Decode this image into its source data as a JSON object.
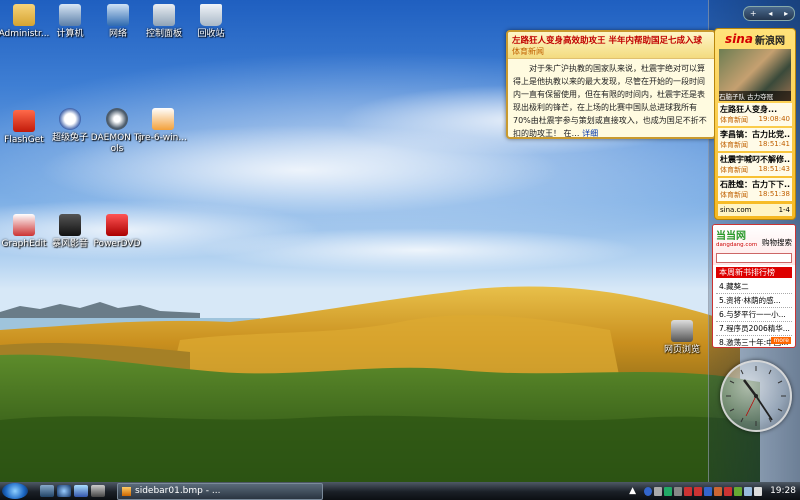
{
  "desktop": {
    "icons": [
      {
        "label": "Administr..."
      },
      {
        "label": "计算机"
      },
      {
        "label": "网络"
      },
      {
        "label": "控制面板"
      },
      {
        "label": "回收站"
      },
      {
        "label": "FlashGet"
      },
      {
        "label": "超级兔子"
      },
      {
        "label": "DAEMON Tools"
      },
      {
        "label": "jre-6-win..."
      },
      {
        "label": "GraphEdit"
      },
      {
        "label": "暴风影音"
      },
      {
        "label": "PowerDVD"
      },
      {
        "label": "网页浏览"
      }
    ]
  },
  "news_popup": {
    "title": "左路狂人变身高效助攻王 半年内帮助国足七成入球",
    "source": "体育新闻",
    "body": "对于朱广沪执教的国家队来说，杜震宇绝对可以算得上是他执教以来的最大发现，尽管在开始的一段时间内一直有保留使用，但在有限的时间内，杜震宇还是表现出极利的锋芒，在上场的比赛中国队总进球我所有70%由杜震宇参与策划或直接攻入，也成为国足不折不扣的助攻王！",
    "ellipsis": "在…",
    "more": "详细"
  },
  "sina_gadget": {
    "logo_s": "sina",
    "logo_cn": "新浪网",
    "photo_caption": "石脑子队 古力夺冠",
    "items": [
      {
        "title": "左路狂人变身...",
        "category": "体育新闻",
        "time": "19:08:40"
      },
      {
        "title": "李昌镐：古力比党...",
        "category": "体育新闻",
        "time": "18:51:41"
      },
      {
        "title": "杜震宇喊叼不解修...",
        "category": "体育新闻",
        "time": "18:51:43"
      },
      {
        "title": "石胜煌：古力下下...",
        "category": "体育新闻",
        "time": "18:51:38"
      }
    ],
    "footer_site": "sina.com",
    "pager": "1-4"
  },
  "dangdang_gadget": {
    "brand": "当当网",
    "url": "dangdang.com",
    "keyword": "购物搜索",
    "rank_title": "本周新书排行榜",
    "books": [
      "4.藏獒二",
      "5.资将·林荫的感...",
      "6.与梦平行一一小...",
      "7.程序员2006精华...",
      "8.激荡三十年:中国..."
    ],
    "more": "more"
  },
  "taskbar": {
    "task_label": "sidebar01.bmp - ...",
    "time": "19:28"
  },
  "colors": {
    "sky_top": "#1f5fc0",
    "grass_gold": "#d8a526",
    "shrub_green": "#3d6e1d",
    "news_title_red": "#c00000"
  }
}
